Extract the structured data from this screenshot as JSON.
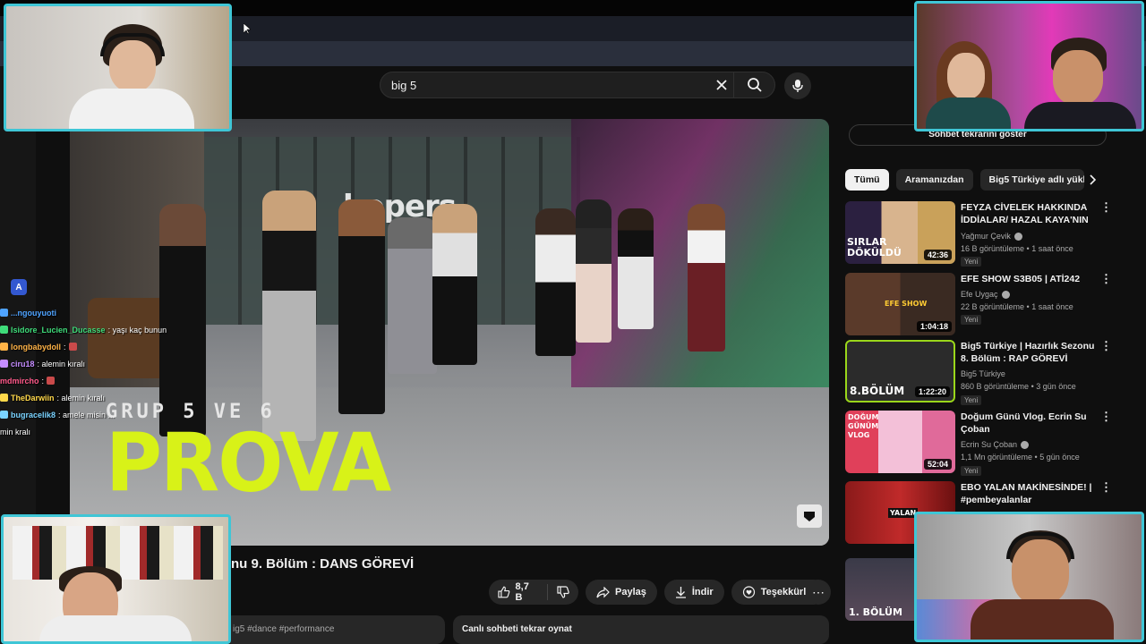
{
  "search": {
    "query": "big 5"
  },
  "video": {
    "overlay_brand": "hopers",
    "overlay_subtitle": "GRUP 5 VE 6",
    "overlay_title": "PROVA",
    "title": "nu 9. Bölüm : DANS GÖREVİ"
  },
  "actions": {
    "like_count": "8,7 B",
    "share_label": "Paylaş",
    "download_label": "İndir",
    "thanks_label": "Teşekkürler"
  },
  "description": {
    "text": "ig5 #dance #performance"
  },
  "chat_replay": {
    "label": "Canlı sohbeti tekrar oynat"
  },
  "sidebar": {
    "show_chat_label": "Sohbet tekrarını göster",
    "chips": [
      "Tümü",
      "Aramanızdan",
      "Big5 Türkiye adlı yükleyic"
    ],
    "recommendations": [
      {
        "title": "FEYZA CİVELEK HAKKINDA İDDİALAR/ HAZAL KAYA'NIN ...",
        "channel": "Yağmur Çevik",
        "verified": true,
        "views": "16 B görüntüleme",
        "age": "1 saat önce",
        "badge": "Yeni",
        "duration": "42:36",
        "thumb_text": "SIRLAR DÖKÜLDÜ"
      },
      {
        "title": "EFE SHOW S3B05 | ATİ242",
        "channel": "Efe Uygaç",
        "verified": true,
        "views": "22 B görüntüleme",
        "age": "1 saat önce",
        "badge": "Yeni",
        "duration": "1:04:18",
        "thumb_text": "EFE SHOW"
      },
      {
        "title": "Big5 Türkiye | Hazırlık Sezonu 8. Bölüm : RAP GÖREVİ",
        "channel": "Big5 Türkiye",
        "verified": false,
        "views": "860 B görüntüleme",
        "age": "3 gün önce",
        "badge": "Yeni",
        "duration": "1:22:20",
        "thumb_text": "8.BÖLÜM"
      },
      {
        "title": "Doğum Günü Vlog. Ecrin Su Çoban",
        "channel": "Ecrin Su Çoban",
        "verified": true,
        "views": "1,1 Mn görüntüleme",
        "age": "5 gün önce",
        "badge": "Yeni",
        "duration": "52:04",
        "thumb_text": "DOĞUM GÜNÜM VLOG"
      },
      {
        "title": "EBO YALAN MAKİNESİNDE! | #pembeyalanlar",
        "channel": "",
        "verified": false,
        "views": "",
        "age": "",
        "badge": "",
        "duration": "",
        "thumb_text": "YALAN"
      },
      {
        "title": "",
        "channel": "",
        "verified": false,
        "views": "",
        "age": "",
        "badge": "",
        "duration": "",
        "thumb_text": "1. BÖLÜM"
      }
    ]
  },
  "chat_overlay": {
    "messages": [
      {
        "user": "...ngouyuoti",
        "text": "",
        "color": "#4fa3ff"
      },
      {
        "user": "Isidore_Lucien_Ducasse",
        "text": ": yaşı kaç bunun",
        "color": "#3fdc7a"
      },
      {
        "user": "longbabydoll",
        "text": ":",
        "color": "#ffb347"
      },
      {
        "user": "ciru18",
        "text": ": alemin kıralı",
        "color": "#c58cff"
      },
      {
        "user": "mdmircho",
        "text": ":",
        "color": "#ff5a8a"
      },
      {
        "user": "TheDarwiin",
        "text": ": alemin kıralı",
        "color": "#ffd84a"
      },
      {
        "user": "bugracelik8",
        "text": ": amele misin ...",
        "color": "#7ad3ff"
      },
      {
        "user": "",
        "text": "min kralı",
        "color": "#ffffff"
      }
    ]
  },
  "colors": {
    "accent_border": "#3fc6d6",
    "overlay_title": "#d8f218",
    "yt_background": "#0f0f0f"
  }
}
